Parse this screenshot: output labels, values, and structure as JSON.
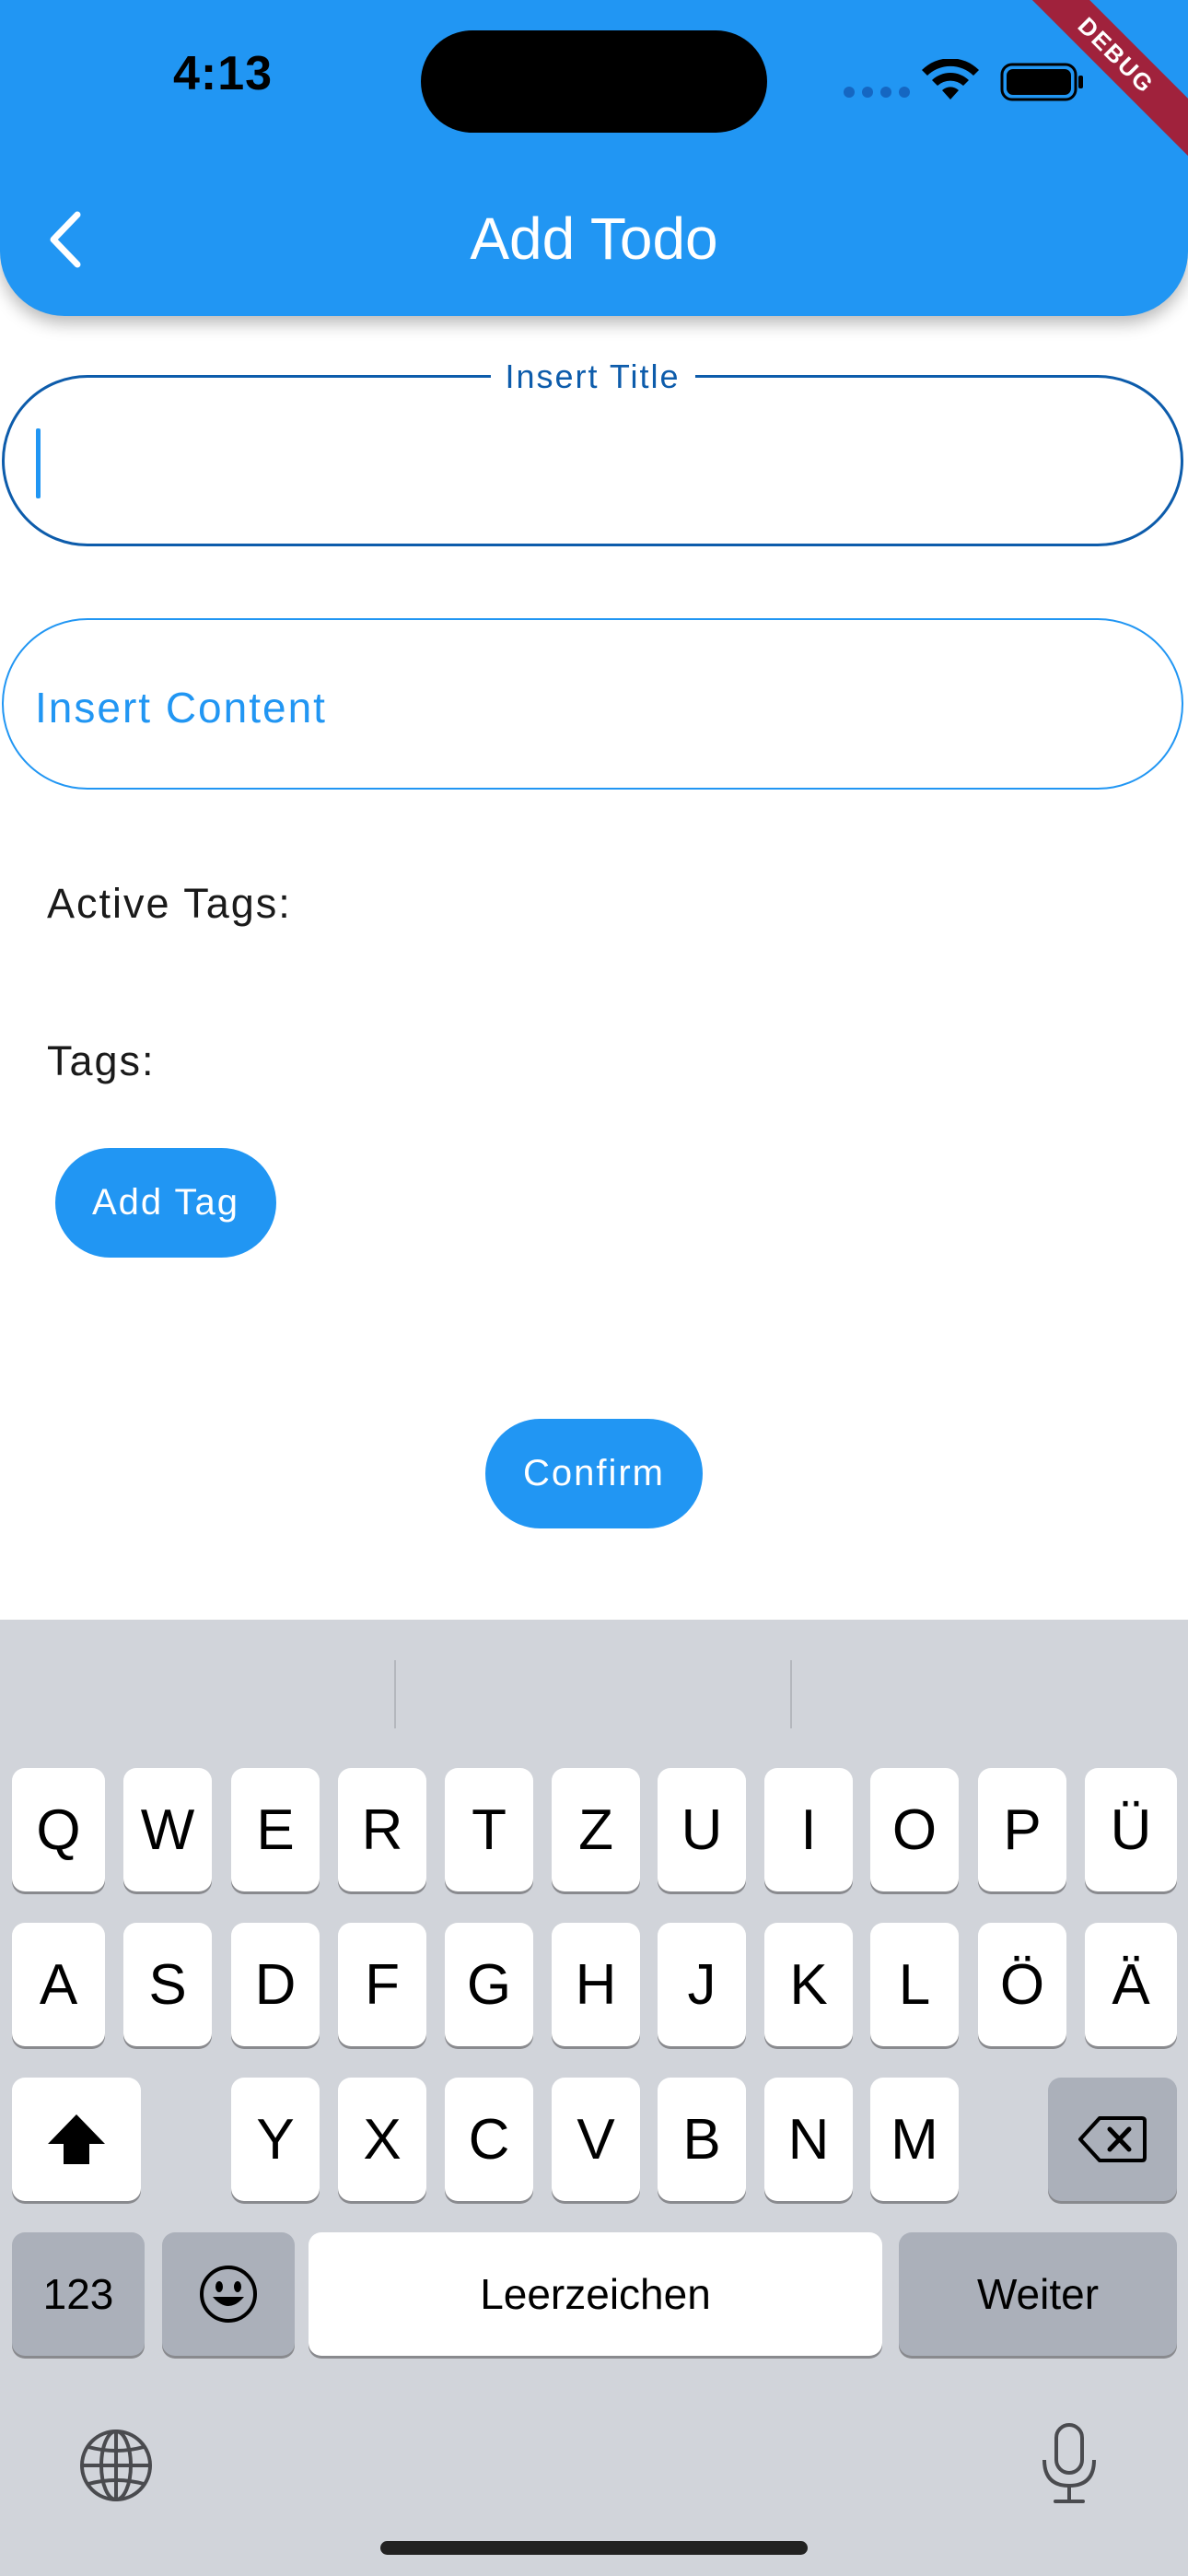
{
  "status_bar": {
    "time": "4:13"
  },
  "debug_banner": "DEBUG",
  "appbar": {
    "title": "Add Todo",
    "back_icon": "chevron-left-icon",
    "color": "#2196F3"
  },
  "title_field": {
    "label": "Insert Title",
    "value": ""
  },
  "content_field": {
    "placeholder": "Insert Content",
    "value": ""
  },
  "active_tags_label": "Active Tags:",
  "tags_label": "Tags:",
  "add_tag_button": "Add Tag",
  "confirm_button": "Confirm",
  "keyboard": {
    "row1": [
      "Q",
      "W",
      "E",
      "R",
      "T",
      "Z",
      "U",
      "I",
      "O",
      "P",
      "Ü"
    ],
    "row2": [
      "A",
      "S",
      "D",
      "F",
      "G",
      "H",
      "J",
      "K",
      "L",
      "Ö",
      "Ä"
    ],
    "row3": [
      "Y",
      "X",
      "C",
      "V",
      "B",
      "N",
      "M"
    ],
    "numbers_key": "123",
    "space_key": "Leerzeichen",
    "return_key": "Weiter",
    "shift_icon": "shift-icon",
    "delete_icon": "backspace-icon",
    "emoji_icon": "emoji-icon",
    "globe_icon": "globe-icon",
    "mic_icon": "microphone-icon"
  }
}
